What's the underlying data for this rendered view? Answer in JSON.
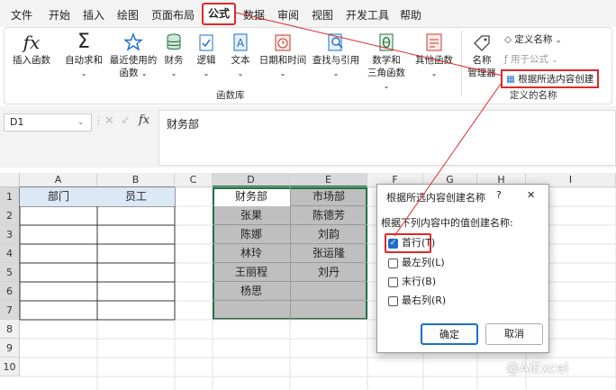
{
  "menu": [
    "文件",
    "开始",
    "插入",
    "绘图",
    "页面布局",
    "公式",
    "数据",
    "审阅",
    "视图",
    "开发工具",
    "帮助"
  ],
  "ribbon": {
    "insert_fn": "插入函数",
    "autosum": "自动求和",
    "recent_1": "最近使用的",
    "recent_2": "函数",
    "financial": "财务",
    "logical": "逻辑",
    "text": "文本",
    "datetime": "日期和时间",
    "lookup": "查找与引用",
    "math_1": "数学和",
    "math_2": "三角函数",
    "more": "其他函数",
    "library_label": "函数库",
    "name_mgr_1": "名称",
    "name_mgr_2": "管理器",
    "define_name": "定义名称",
    "use_in_formula": "用于公式",
    "create_from_sel": "根据所选内容创建",
    "defined_names_label": "定义的名称",
    "fx_glyph": "fx",
    "sigma_glyph": "Σ"
  },
  "formula_bar": {
    "name_box": "D1",
    "fx": "fx",
    "content": "财务部"
  },
  "columns": [
    "A",
    "B",
    "C",
    "D",
    "E",
    "F",
    "G",
    "H",
    "I"
  ],
  "rows": [
    "1",
    "2",
    "3",
    "4",
    "5",
    "6",
    "7",
    "8",
    "9",
    "10"
  ],
  "cells": {
    "A1": "部门",
    "B1": "员工",
    "D1": "财务部",
    "E1": "市场部",
    "D2": "张果",
    "E2": "陈德芳",
    "D3": "陈娜",
    "E3": "刘韵",
    "D4": "林玲",
    "E4": "张运隆",
    "D5": "王丽程",
    "E5": "刘丹",
    "D6": "杨思"
  },
  "dialog": {
    "title": "根据所选内容创建名称",
    "help": "?",
    "close": "✕",
    "prompt": "根据下列内容中的值创建名称:",
    "options": [
      {
        "label": "首行(T)",
        "checked": true
      },
      {
        "label": "最左列(L)",
        "checked": false
      },
      {
        "label": "末行(B)",
        "checked": false
      },
      {
        "label": "最右列(R)",
        "checked": false
      }
    ],
    "ok": "确定",
    "cancel": "取消"
  },
  "watermark": "@AiExcel",
  "colors": {
    "accent": "#e0282a",
    "selection": "#217346",
    "header_fill": "#dbe8f5",
    "selected_fill": "#bfbfbf"
  }
}
